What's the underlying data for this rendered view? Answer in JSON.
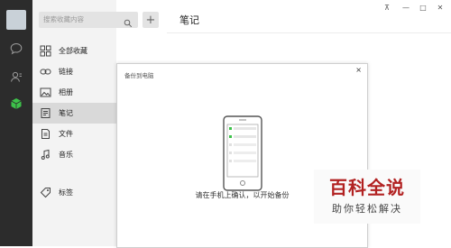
{
  "sidebar": {
    "search_placeholder": "搜索收藏内容",
    "items": [
      {
        "label": "全部收藏",
        "icon": "grid-icon"
      },
      {
        "label": "链接",
        "icon": "link-icon"
      },
      {
        "label": "相册",
        "icon": "image-icon"
      },
      {
        "label": "笔记",
        "icon": "note-icon",
        "active": true
      },
      {
        "label": "文件",
        "icon": "file-icon"
      },
      {
        "label": "音乐",
        "icon": "music-icon"
      },
      {
        "label": "标签",
        "icon": "tag-icon"
      }
    ]
  },
  "rail": {
    "icons": [
      "chat-icon",
      "contacts-icon",
      "favorites-cube-icon"
    ],
    "accent": "#3dc24a"
  },
  "main": {
    "title": "笔记"
  },
  "window_controls": {
    "pin": "⊼",
    "minimize": "—",
    "maximize": "□",
    "close": "✕"
  },
  "dialog": {
    "title": "备份到电脑",
    "close": "×",
    "message": "请在手机上确认，以开始备份"
  },
  "watermark": {
    "title": "百科全说",
    "subtitle": "助你轻松解决",
    "color": "#b22222"
  }
}
